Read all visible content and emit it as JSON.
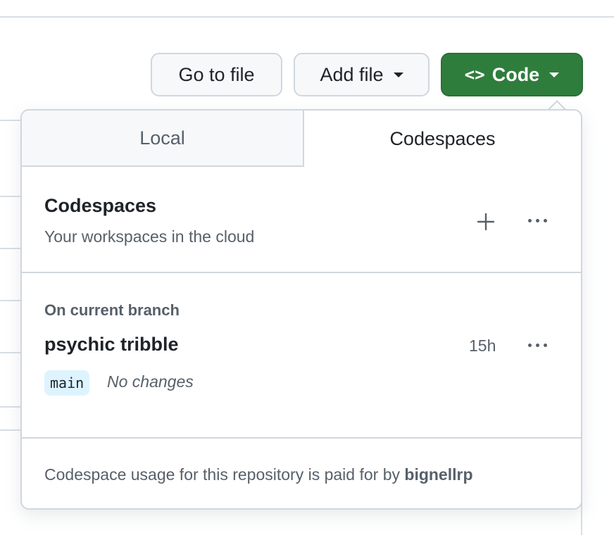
{
  "toolbar": {
    "goto_label": "Go to file",
    "add_label": "Add file",
    "code_glyph": "<>",
    "code_label": "Code",
    "code_color": "#2f7d3d"
  },
  "dropdown": {
    "tabs": [
      {
        "label": "Local",
        "active": false
      },
      {
        "label": "Codespaces",
        "active": true
      }
    ],
    "header": {
      "title": "Codespaces",
      "subtitle": "Your workspaces in the cloud",
      "add_icon": "plus-icon",
      "more_icon": "kebab-icon"
    },
    "section_label": "On current branch",
    "codespace": {
      "name": "psychic tribble",
      "time": "15h",
      "branch": "main",
      "status": "No changes"
    },
    "footer": {
      "text": "Codespace usage for this repository is paid for by",
      "owner": "bignellrp"
    }
  }
}
